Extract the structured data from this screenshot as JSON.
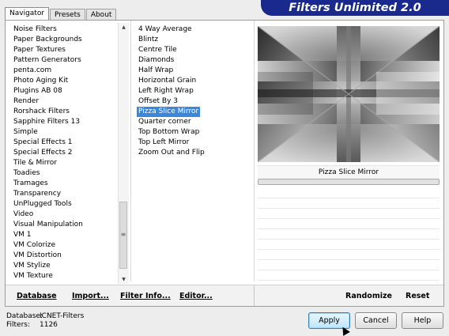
{
  "header": {
    "logo_text": "Filters Unlimited 2.0"
  },
  "tabs": [
    {
      "label": "Navigator",
      "active": true
    },
    {
      "label": "Presets",
      "active": false
    },
    {
      "label": "About",
      "active": false
    }
  ],
  "categories": [
    "Noise Filters",
    "Paper Backgrounds",
    "Paper Textures",
    "Pattern Generators",
    "penta.com",
    "Photo Aging Kit",
    "Plugins AB 08",
    "Render",
    "Rorshack Filters",
    "Sapphire Filters 13",
    "Simple",
    "Special Effects 1",
    "Special Effects 2",
    "Tile & Mirror",
    "Toadies",
    "Tramages",
    "Transparency",
    "UnPlugged Tools",
    "Video",
    "Visual Manipulation",
    "VM 1",
    "VM Colorize",
    "VM Distortion",
    "VM Stylize",
    "VM Texture"
  ],
  "filters": {
    "items": [
      "4 Way Average",
      "Blintz",
      "Centre Tile",
      "Diamonds",
      "Half Wrap",
      "Horizontal Grain",
      "Left Right Wrap",
      "Offset By 3",
      "Pizza Slice Mirror",
      "Quarter corner",
      "Top Bottom Wrap",
      "Top Left Mirror",
      "Zoom Out and Flip"
    ],
    "selected": "Pizza Slice Mirror"
  },
  "preview": {
    "filter_name": "Pizza Slice Mirror"
  },
  "toolbar": {
    "database": "Database",
    "import": "Import...",
    "filter_info": "Filter Info...",
    "editor": "Editor...",
    "randomize": "Randomize",
    "reset": "Reset"
  },
  "info": {
    "database_label": "Database:",
    "database_value": "ICNET-Filters",
    "filters_label": "Filters:",
    "filters_value": "1126"
  },
  "buttons": {
    "apply": "Apply",
    "cancel": "Cancel",
    "help": "Help"
  },
  "colors": {
    "logo_bg": "#1a2a8c",
    "selection": "#3b87d9"
  }
}
